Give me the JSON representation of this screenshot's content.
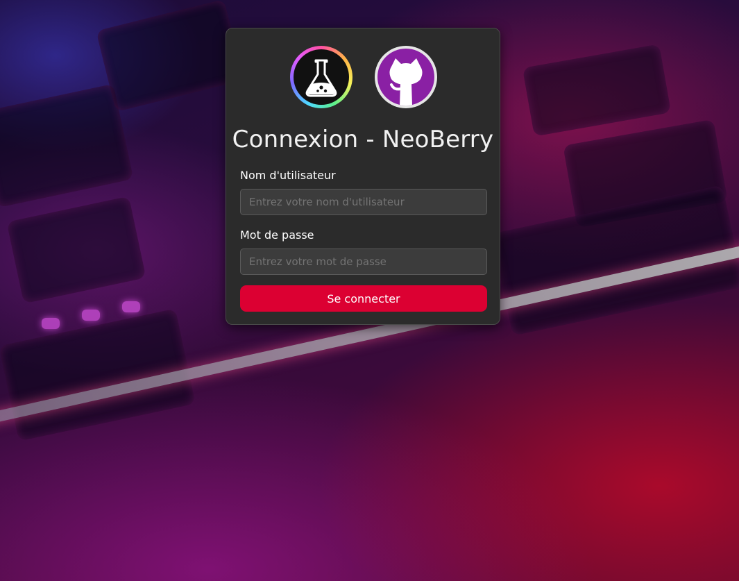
{
  "login": {
    "title": "Connexion - NeoBerry",
    "username_label": "Nom d'utilisateur",
    "username_placeholder": "Entrez votre nom d'utilisateur",
    "username_value": "",
    "password_label": "Mot de passe",
    "password_placeholder": "Entrez votre mot de passe",
    "password_value": "",
    "submit_label": "Se connecter"
  },
  "logos": [
    {
      "icon": "flask-icon"
    },
    {
      "icon": "github-octocat-icon"
    }
  ],
  "colors": {
    "primary_button": "#dc0032",
    "card_background": "#2b2b2b",
    "input_background": "#3c3c3c",
    "github_logo_background": "#8a20a4"
  }
}
